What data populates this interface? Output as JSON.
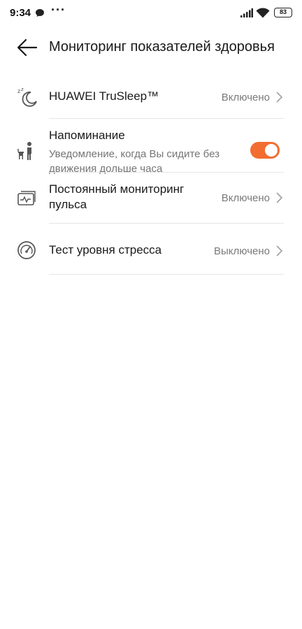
{
  "status_bar": {
    "time": "9:34",
    "dots": "···",
    "battery": "83",
    "icons": [
      "chat-bubble-icon",
      "signal-icon",
      "wifi-icon",
      "battery-icon"
    ]
  },
  "header": {
    "title": "Мониторинг показателей здоровья",
    "back_icon": "arrow-left-icon"
  },
  "colors": {
    "accent": "#f36c30",
    "text": "#1a1a1a",
    "secondary_text": "#7a7a7a",
    "divider": "#e6e6e6"
  },
  "rows": [
    {
      "title": "HUAWEI TruSleep™",
      "value": "Включено",
      "icon": "sleep-moon-icon"
    },
    {
      "title": "Напоминание",
      "subtitle": "Уведомление, когда Вы сидите без движения дольше часа",
      "toggle_on": true,
      "icon": "sitting-person-icon"
    },
    {
      "title": "Постоянный мониторинг пульса",
      "value": "Включено",
      "icon": "heart-rate-monitor-icon"
    },
    {
      "title": "Тест уровня стресса",
      "value": "Выключено",
      "icon": "gauge-icon"
    }
  ]
}
